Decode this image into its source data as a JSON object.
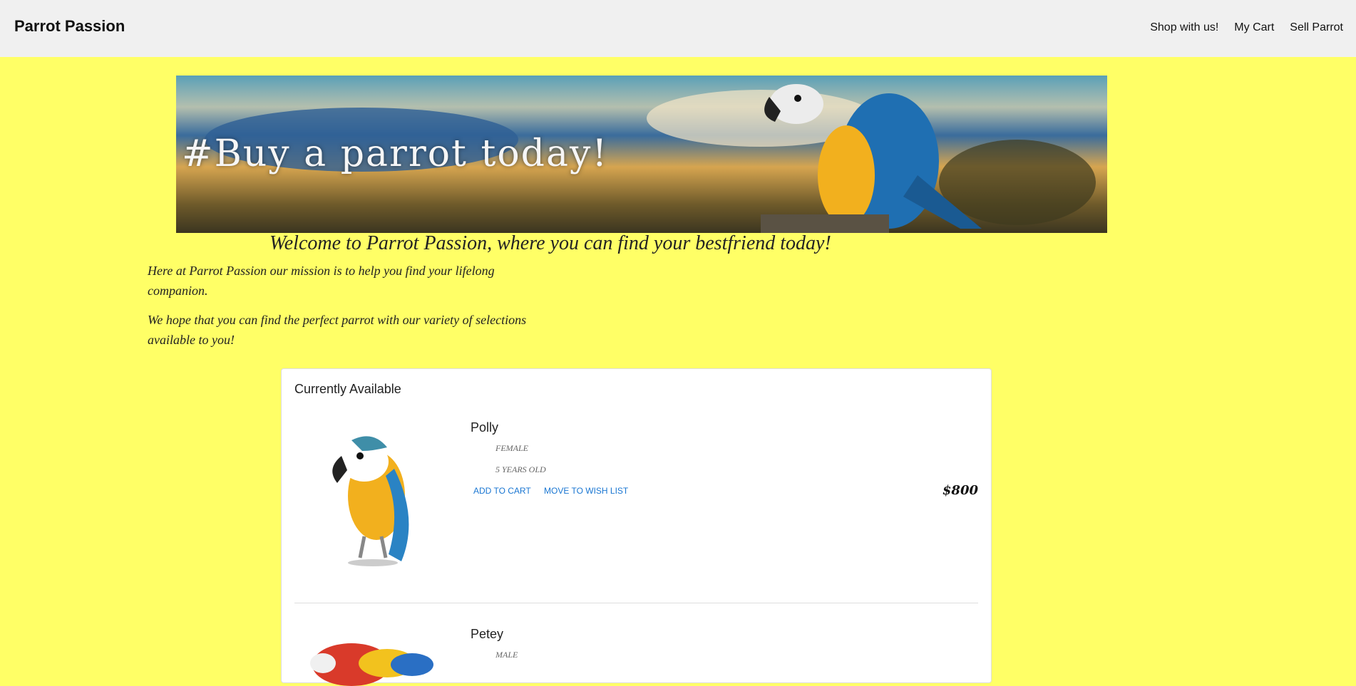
{
  "navbar": {
    "brand": "Parrot Passion",
    "links": [
      "Shop with us!",
      "My Cart",
      "Sell Parrot"
    ]
  },
  "banner": {
    "text": "#Buy a parrot today!"
  },
  "welcome": "Welcome to Parrot Passion, where you can find your bestfriend today!",
  "intro": [
    "Here at Parrot Passion our mission is to help you find your lifelong companion.",
    "We hope that you can find the perfect parrot with our variety of selections available to you!"
  ],
  "card": {
    "title": "Currently Available",
    "items": [
      {
        "name": "Polly",
        "sex": "FEMALE",
        "age": "5 YEARS OLD",
        "add_label": "ADD TO CART",
        "wish_label": "MOVE TO WISH LIST",
        "price": "$800"
      },
      {
        "name": "Petey",
        "sex": "MALE"
      }
    ]
  },
  "colors": {
    "page_bg": "#ffff66",
    "navbar_bg": "#f0f0f0",
    "link_blue": "#1976d2"
  }
}
